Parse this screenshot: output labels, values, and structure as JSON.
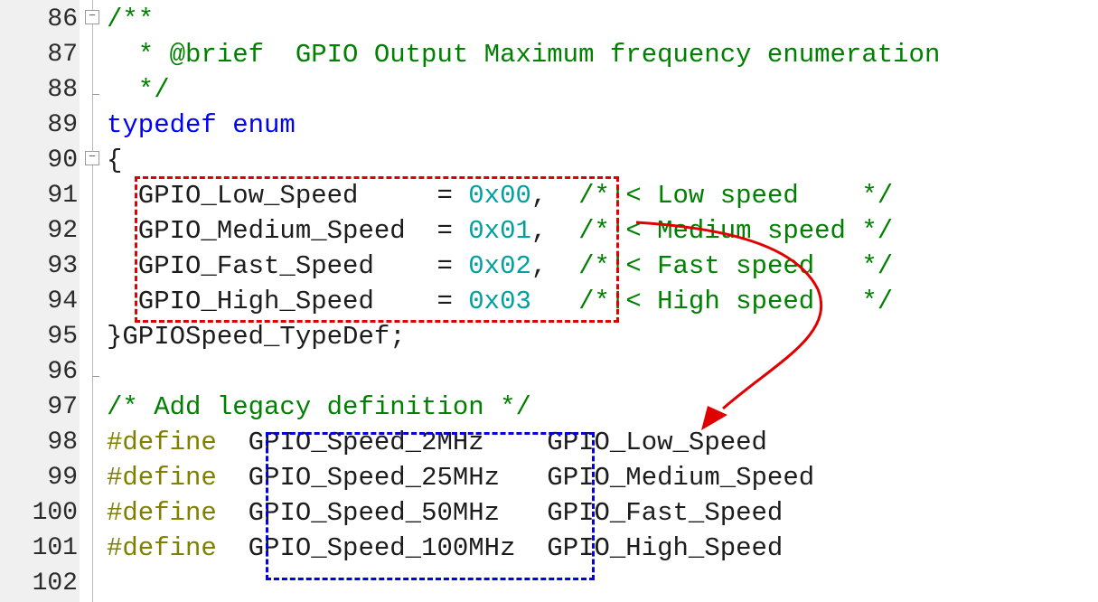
{
  "editor": {
    "lines": [
      {
        "num": "86",
        "fold": "⊟",
        "segments": [
          {
            "t": "/**",
            "c": "comment"
          }
        ]
      },
      {
        "num": "87",
        "segments": [
          {
            "t": "  * @brief  GPIO Output Maximum frequency enumeration",
            "c": "comment"
          }
        ]
      },
      {
        "num": "88",
        "tick": true,
        "segments": [
          {
            "t": "  */",
            "c": "comment"
          }
        ]
      },
      {
        "num": "89",
        "segments": [
          {
            "t": "typedef enum",
            "c": "keyword"
          }
        ]
      },
      {
        "num": "90",
        "fold": "⊟",
        "segments": [
          {
            "t": "{",
            "c": "plain"
          }
        ]
      },
      {
        "num": "91",
        "segments": [
          {
            "t": "  GPIO_Low_Speed     = ",
            "c": "plain"
          },
          {
            "t": "0x00",
            "c": "number"
          },
          {
            "t": ",  ",
            "c": "plain"
          },
          {
            "t": "/*!< Low speed    */",
            "c": "comment"
          }
        ]
      },
      {
        "num": "92",
        "segments": [
          {
            "t": "  GPIO_Medium_Speed  = ",
            "c": "plain"
          },
          {
            "t": "0x01",
            "c": "number"
          },
          {
            "t": ",  ",
            "c": "plain"
          },
          {
            "t": "/*!< Medium speed */",
            "c": "comment"
          }
        ]
      },
      {
        "num": "93",
        "segments": [
          {
            "t": "  GPIO_Fast_Speed    = ",
            "c": "plain"
          },
          {
            "t": "0x02",
            "c": "number"
          },
          {
            "t": ",  ",
            "c": "plain"
          },
          {
            "t": "/*!< Fast speed   */",
            "c": "comment"
          }
        ]
      },
      {
        "num": "94",
        "segments": [
          {
            "t": "  GPIO_High_Speed    = ",
            "c": "plain"
          },
          {
            "t": "0x03",
            "c": "number"
          },
          {
            "t": "   ",
            "c": "plain"
          },
          {
            "t": "/*!< High speed   */",
            "c": "comment"
          }
        ]
      },
      {
        "num": "95",
        "segments": [
          {
            "t": "}GPIOSpeed_TypeDef;",
            "c": "plain"
          }
        ]
      },
      {
        "num": "96",
        "tick": true,
        "segments": []
      },
      {
        "num": "97",
        "segments": [
          {
            "t": "/* Add legacy definition */",
            "c": "comment"
          }
        ]
      },
      {
        "num": "98",
        "segments": [
          {
            "t": "#define",
            "c": "preproc"
          },
          {
            "t": "  GPIO_Speed_2MHz    GPIO_Low_Speed",
            "c": "plain"
          }
        ]
      },
      {
        "num": "99",
        "segments": [
          {
            "t": "#define",
            "c": "preproc"
          },
          {
            "t": "  GPIO_Speed_25MHz   GPIO_Medium_Speed",
            "c": "plain"
          }
        ]
      },
      {
        "num": "100",
        "segments": [
          {
            "t": "#define",
            "c": "preproc"
          },
          {
            "t": "  GPIO_Speed_50MHz   GPIO_Fast_Speed",
            "c": "plain"
          }
        ]
      },
      {
        "num": "101",
        "segments": [
          {
            "t": "#define",
            "c": "preproc"
          },
          {
            "t": "  GPIO_Speed_100MHz  GPIO_High_Speed",
            "c": "plain"
          }
        ]
      },
      {
        "num": "102",
        "segments": []
      }
    ],
    "colors": {
      "comment": "#008000",
      "keyword": "#0000ff",
      "preproc": "#808000",
      "number": "#00a0a0",
      "annotation_red": "#e00000",
      "annotation_blue": "#0000e0"
    }
  }
}
